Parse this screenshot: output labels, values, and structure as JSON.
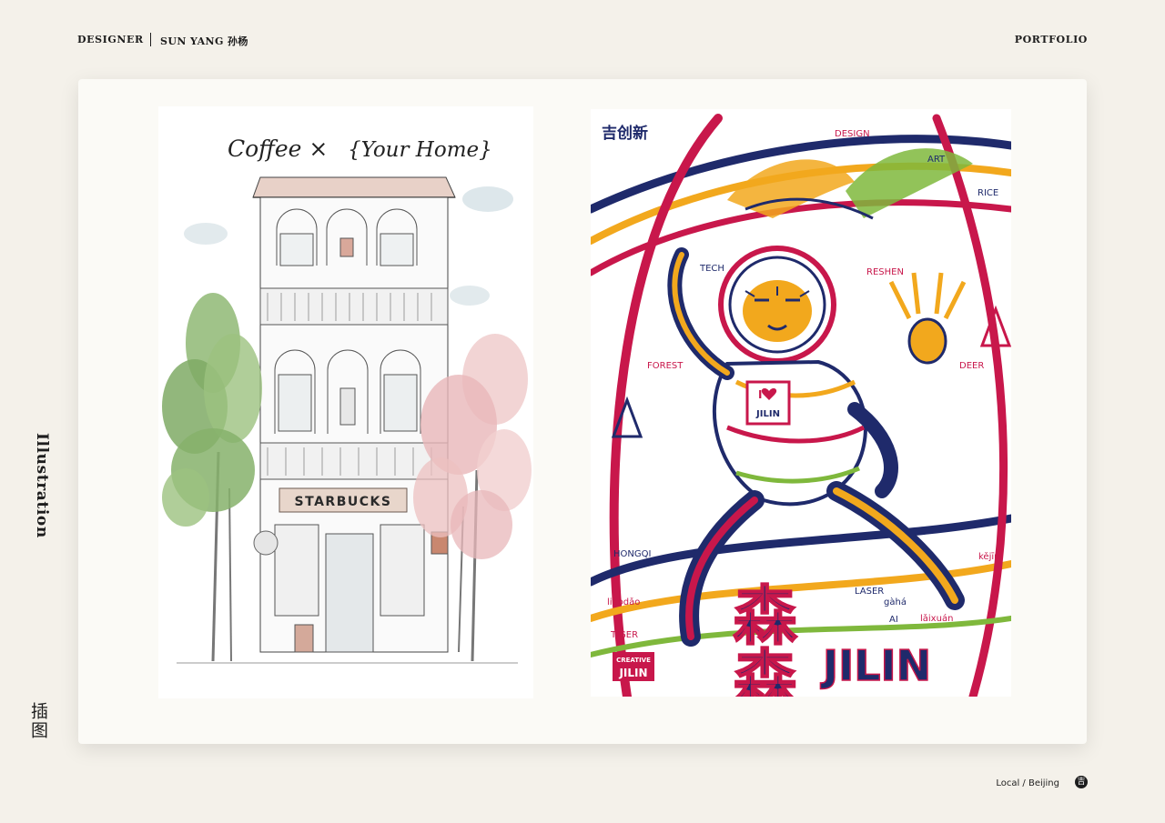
{
  "header": {
    "designer_label": "DESIGNER",
    "designer_name": "SUN YANG 孙杨",
    "portfolio_label": "PORTFOLIO"
  },
  "sidebar": {
    "title_en": "Illustration",
    "title_cn": "插图"
  },
  "artwork_left": {
    "headline_1": "Coffee ×",
    "headline_2": "{Your Home}",
    "sign": "STARBUCKS"
  },
  "artwork_right": {
    "logo_cn": "吉创新",
    "words": {
      "design": "DESIGN",
      "art": "ART",
      "rice": "RICE",
      "tech": "TECH",
      "reshen": "RESHEN",
      "forest": "FOREST",
      "deer": "DEER",
      "hongqi": "HONGQI",
      "kejin": "kějīn",
      "liaodao": "liàodǎo",
      "laser": "LASER",
      "gaha": "gàhá",
      "ai": "AI",
      "laixuan": "lǎixuán",
      "tiger": "TIGER",
      "badge_top": "I",
      "badge_bottom": "JILIN"
    },
    "creative_label": "CREATIVE",
    "creative_brand": "JILIN",
    "big_cn": "森森",
    "big_en": "JILIN"
  },
  "footer": {
    "location": "Local / Beijing",
    "logo_char": "吉"
  },
  "colors": {
    "background": "#f4f1ea",
    "card": "#fbfaf6",
    "red": "#c8174b",
    "navy": "#1f2a6b",
    "yellow": "#f2a81d",
    "green": "#7fb83c"
  }
}
